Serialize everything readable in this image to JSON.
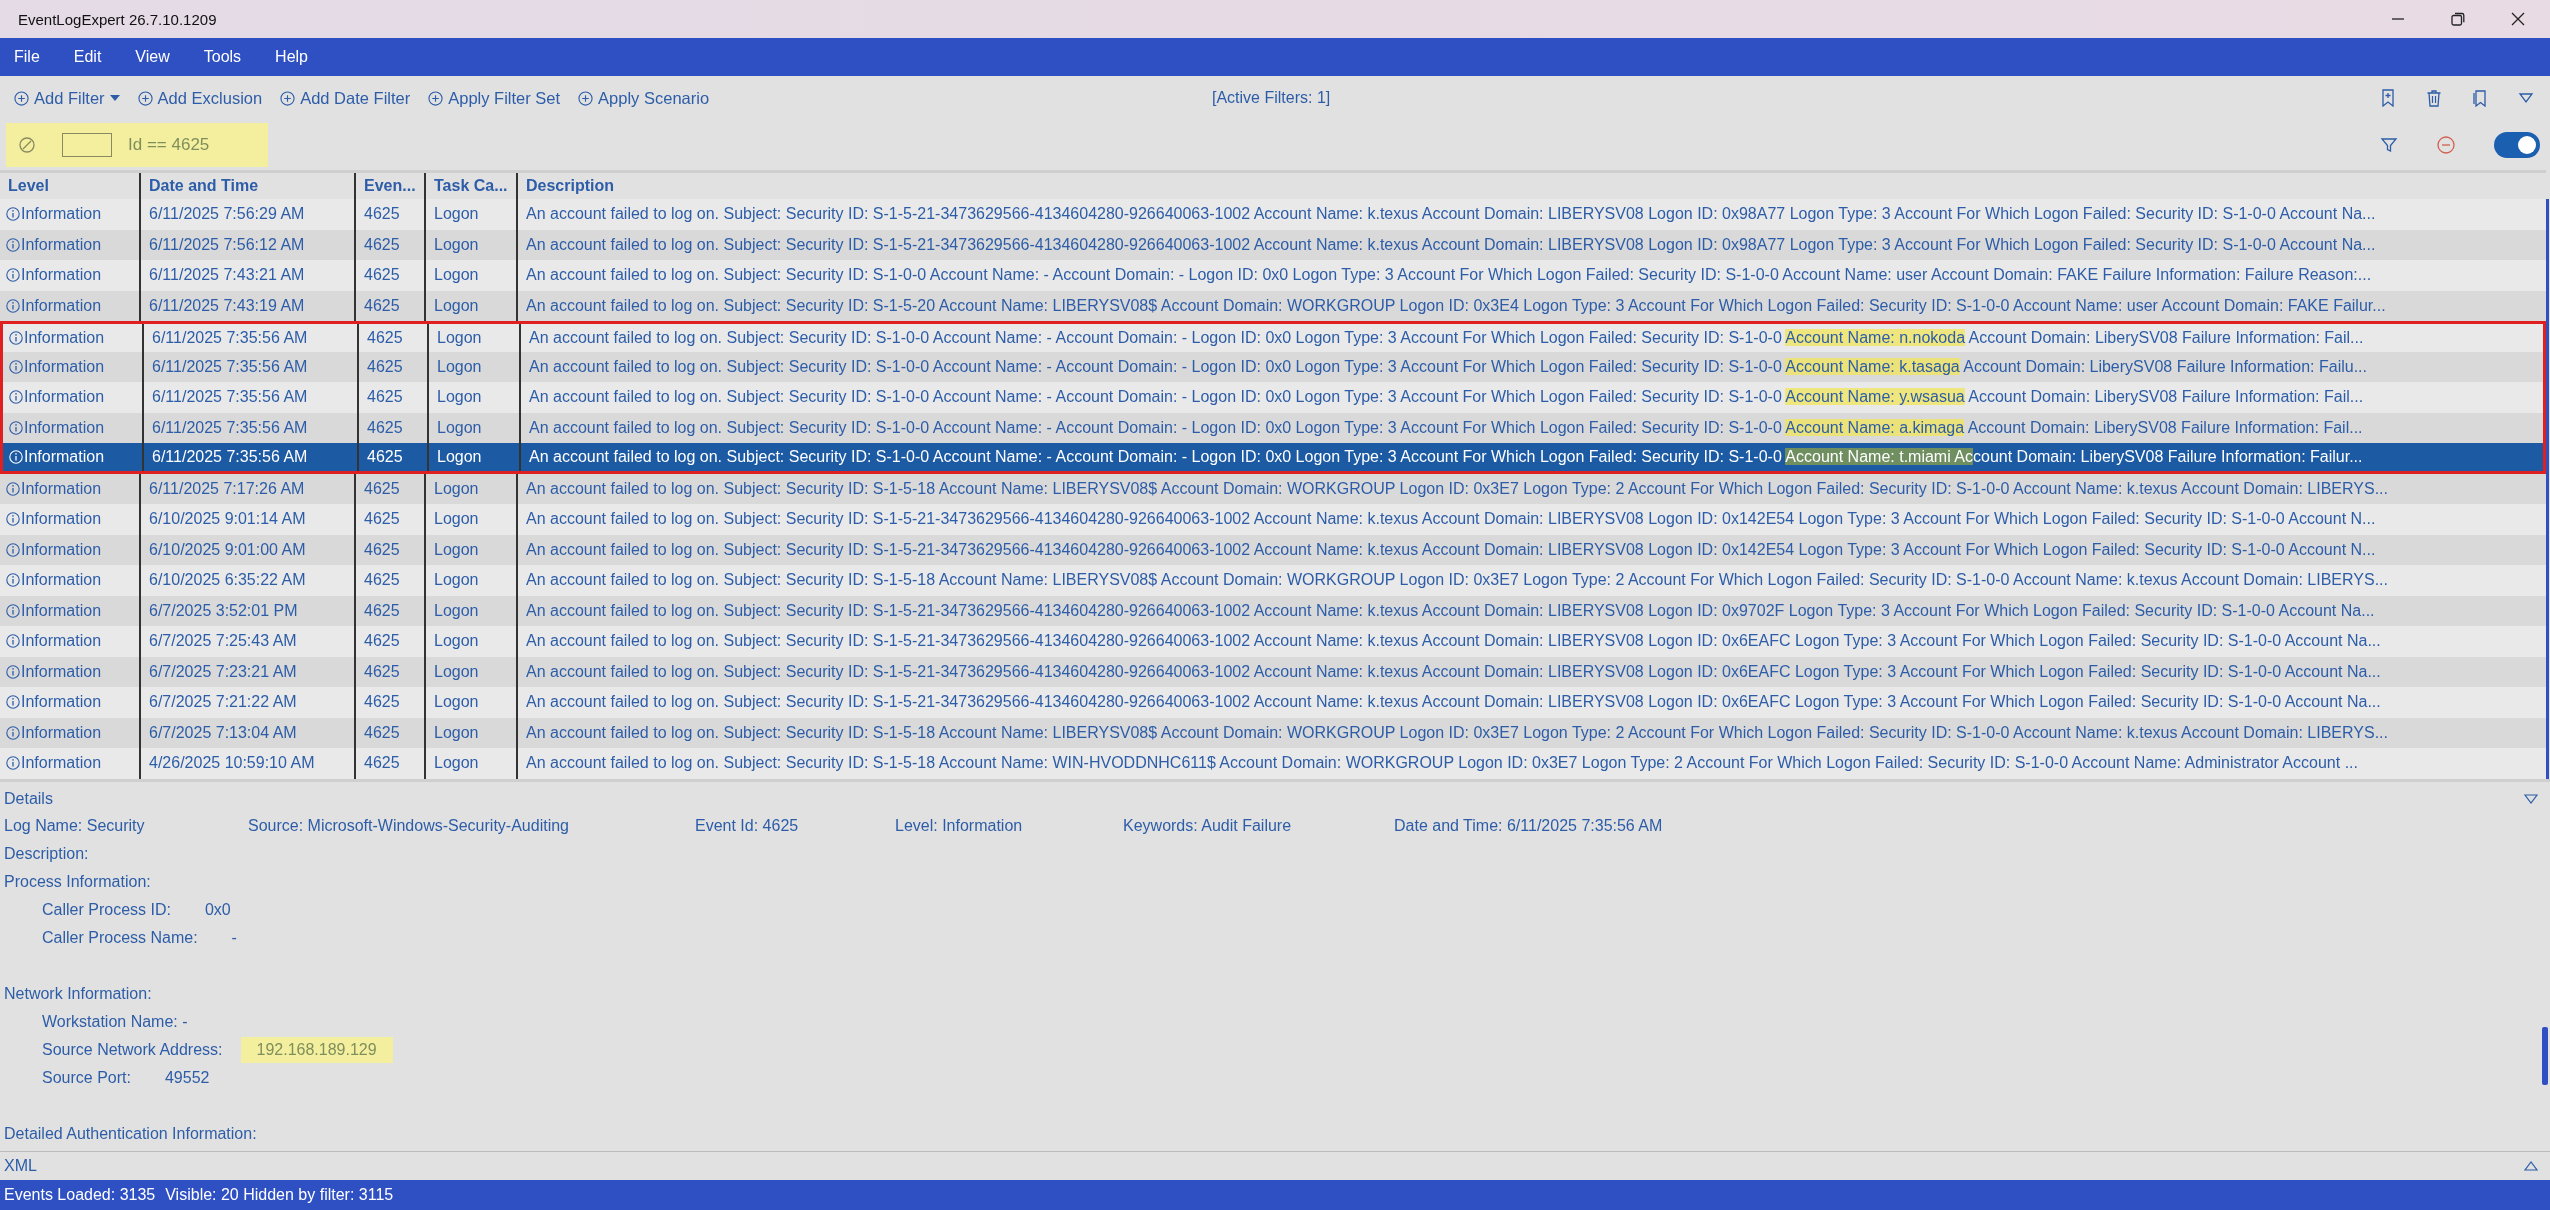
{
  "window": {
    "title": "EventLogExpert 26.7.10.1209"
  },
  "menu": [
    "File",
    "Edit",
    "View",
    "Tools",
    "Help"
  ],
  "toolbar": {
    "buttons": [
      {
        "label": "Add Filter",
        "dropdown": true
      },
      {
        "label": "Add Exclusion",
        "dropdown": false
      },
      {
        "label": "Add Date Filter",
        "dropdown": false
      },
      {
        "label": "Apply Filter Set",
        "dropdown": false
      },
      {
        "label": "Apply Scenario",
        "dropdown": false
      }
    ],
    "active_filters": "[Active Filters: 1]"
  },
  "filter": {
    "value": "Id == 4625",
    "highlighted": true,
    "enabled": true
  },
  "table": {
    "columns": [
      "Level",
      "Date and Time",
      "Even...",
      "Task Ca...",
      "Description"
    ],
    "rows": [
      {
        "level": "Information",
        "date": "6/11/2025 7:56:29 AM",
        "event_id": "4625",
        "task": "Logon",
        "selected": false,
        "outlined": false,
        "description": [
          {
            "text": "An account failed to log on. Subject: Security ID: S-1-5-21-3473629566-4134604280-926640063-1002 Account Name: k.texus Account Domain: LIBERYSV08 Logon ID: 0x98A77 Logon Type: 3 Account For Which Logon Failed: Security ID: S-1-0-0 Account Na...",
            "highlighted": false
          }
        ]
      },
      {
        "level": "Information",
        "date": "6/11/2025 7:56:12 AM",
        "event_id": "4625",
        "task": "Logon",
        "selected": false,
        "outlined": false,
        "description": [
          {
            "text": "An account failed to log on. Subject: Security ID: S-1-5-21-3473629566-4134604280-926640063-1002 Account Name: k.texus Account Domain: LIBERYSV08 Logon ID: 0x98A77 Logon Type: 3 Account For Which Logon Failed: Security ID: S-1-0-0 Account Na...",
            "highlighted": false
          }
        ]
      },
      {
        "level": "Information",
        "date": "6/11/2025 7:43:21 AM",
        "event_id": "4625",
        "task": "Logon",
        "selected": false,
        "outlined": false,
        "description": [
          {
            "text": "An account failed to log on. Subject: Security ID: S-1-0-0 Account Name: - Account Domain: - Logon ID: 0x0 Logon Type: 3 Account For Which Logon Failed: Security ID: S-1-0-0 Account Name: user Account Domain: FAKE Failure Information: Failure Reason:...",
            "highlighted": false
          }
        ]
      },
      {
        "level": "Information",
        "date": "6/11/2025 7:43:19 AM",
        "event_id": "4625",
        "task": "Logon",
        "selected": false,
        "outlined": false,
        "description": [
          {
            "text": "An account failed to log on. Subject: Security ID: S-1-5-20 Account Name: LIBERYSV08$ Account Domain: WORKGROUP Logon ID: 0x3E4 Logon Type: 3 Account For Which Logon Failed: Security ID: S-1-0-0 Account Name: user Account Domain: FAKE Failur...",
            "highlighted": false
          }
        ]
      },
      {
        "level": "Information",
        "date": "6/11/2025 7:35:56 AM",
        "event_id": "4625",
        "task": "Logon",
        "selected": false,
        "outlined": true,
        "description": [
          {
            "text": "An account failed to log on. Subject: Security ID: S-1-0-0 Account Name: - Account Domain: - Logon ID: 0x0 Logon Type: 3 Account For Which Logon Failed: Security ID: S-1-0-0 ",
            "highlighted": false
          },
          {
            "text": "Account Name: n.nokoda",
            "highlighted": true
          },
          {
            "text": " Account Domain: LiberySV08 Failure Information: Fail...",
            "highlighted": false
          }
        ]
      },
      {
        "level": "Information",
        "date": "6/11/2025 7:35:56 AM",
        "event_id": "4625",
        "task": "Logon",
        "selected": false,
        "outlined": true,
        "description": [
          {
            "text": "An account failed to log on. Subject: Security ID: S-1-0-0 Account Name: - Account Domain: - Logon ID: 0x0 Logon Type: 3 Account For Which Logon Failed: Security ID: S-1-0-0 ",
            "highlighted": false
          },
          {
            "text": "Account Name: k.tasaga",
            "highlighted": true
          },
          {
            "text": " Account Domain: LiberySV08 Failure Information: Failu...",
            "highlighted": false
          }
        ]
      },
      {
        "level": "Information",
        "date": "6/11/2025 7:35:56 AM",
        "event_id": "4625",
        "task": "Logon",
        "selected": false,
        "outlined": true,
        "description": [
          {
            "text": "An account failed to log on. Subject: Security ID: S-1-0-0 Account Name: - Account Domain: - Logon ID: 0x0 Logon Type: 3 Account For Which Logon Failed: Security ID: S-1-0-0 ",
            "highlighted": false
          },
          {
            "text": "Account Name: y.wsasua",
            "highlighted": true
          },
          {
            "text": " Account Domain: LiberySV08 Failure Information: Fail...",
            "highlighted": false
          }
        ]
      },
      {
        "level": "Information",
        "date": "6/11/2025 7:35:56 AM",
        "event_id": "4625",
        "task": "Logon",
        "selected": false,
        "outlined": true,
        "description": [
          {
            "text": "An account failed to log on. Subject: Security ID: S-1-0-0 Account Name: - Account Domain: - Logon ID: 0x0 Logon Type: 3 Account For Which Logon Failed: Security ID: S-1-0-0 ",
            "highlighted": false
          },
          {
            "text": "Account Name: a.kimaga",
            "highlighted": true
          },
          {
            "text": " Account Domain: LiberySV08 Failure Information: Fail...",
            "highlighted": false
          }
        ]
      },
      {
        "level": "Information",
        "date": "6/11/2025 7:35:56 AM",
        "event_id": "4625",
        "task": "Logon",
        "selected": true,
        "outlined": true,
        "description": [
          {
            "text": "An account failed to log on. Subject: Security ID: S-1-0-0 Account Name: - Account Domain: - Logon ID: 0x0 Logon Type: 3 Account For Which Logon Failed: Security ID: S-1-0-0 ",
            "highlighted": false
          },
          {
            "text": "Account Name: t.miami Ac",
            "highlighted": true
          },
          {
            "text": "count Domain: LiberySV08 Failure Information: Failur...",
            "highlighted": false
          }
        ]
      },
      {
        "level": "Information",
        "date": "6/11/2025 7:17:26 AM",
        "event_id": "4625",
        "task": "Logon",
        "selected": false,
        "outlined": false,
        "description": [
          {
            "text": "An account failed to log on. Subject: Security ID: S-1-5-18 Account Name: LIBERYSV08$ Account Domain: WORKGROUP Logon ID: 0x3E7 Logon Type: 2 Account For Which Logon Failed: Security ID: S-1-0-0 Account Name: k.texus Account Domain: LIBERYS...",
            "highlighted": false
          }
        ]
      },
      {
        "level": "Information",
        "date": "6/10/2025 9:01:14 AM",
        "event_id": "4625",
        "task": "Logon",
        "selected": false,
        "outlined": false,
        "description": [
          {
            "text": "An account failed to log on. Subject: Security ID: S-1-5-21-3473629566-4134604280-926640063-1002 Account Name: k.texus Account Domain: LIBERYSV08 Logon ID: 0x142E54 Logon Type: 3 Account For Which Logon Failed: Security ID: S-1-0-0 Account N...",
            "highlighted": false
          }
        ]
      },
      {
        "level": "Information",
        "date": "6/10/2025 9:01:00 AM",
        "event_id": "4625",
        "task": "Logon",
        "selected": false,
        "outlined": false,
        "description": [
          {
            "text": "An account failed to log on. Subject: Security ID: S-1-5-21-3473629566-4134604280-926640063-1002 Account Name: k.texus Account Domain: LIBERYSV08 Logon ID: 0x142E54 Logon Type: 3 Account For Which Logon Failed: Security ID: S-1-0-0 Account N...",
            "highlighted": false
          }
        ]
      },
      {
        "level": "Information",
        "date": "6/10/2025 6:35:22 AM",
        "event_id": "4625",
        "task": "Logon",
        "selected": false,
        "outlined": false,
        "description": [
          {
            "text": "An account failed to log on. Subject: Security ID: S-1-5-18 Account Name: LIBERYSV08$ Account Domain: WORKGROUP Logon ID: 0x3E7 Logon Type: 2 Account For Which Logon Failed: Security ID: S-1-0-0 Account Name: k.texus Account Domain: LIBERYS...",
            "highlighted": false
          }
        ]
      },
      {
        "level": "Information",
        "date": "6/7/2025 3:52:01 PM",
        "event_id": "4625",
        "task": "Logon",
        "selected": false,
        "outlined": false,
        "description": [
          {
            "text": "An account failed to log on. Subject: Security ID: S-1-5-21-3473629566-4134604280-926640063-1002 Account Name: k.texus Account Domain: LIBERYSV08 Logon ID: 0x9702F Logon Type: 3 Account For Which Logon Failed: Security ID: S-1-0-0 Account Na...",
            "highlighted": false
          }
        ]
      },
      {
        "level": "Information",
        "date": "6/7/2025 7:25:43 AM",
        "event_id": "4625",
        "task": "Logon",
        "selected": false,
        "outlined": false,
        "description": [
          {
            "text": "An account failed to log on. Subject: Security ID: S-1-5-21-3473629566-4134604280-926640063-1002 Account Name: k.texus Account Domain: LIBERYSV08 Logon ID: 0x6EAFC Logon Type: 3 Account For Which Logon Failed: Security ID: S-1-0-0 Account Na...",
            "highlighted": false
          }
        ]
      },
      {
        "level": "Information",
        "date": "6/7/2025 7:23:21 AM",
        "event_id": "4625",
        "task": "Logon",
        "selected": false,
        "outlined": false,
        "description": [
          {
            "text": "An account failed to log on. Subject: Security ID: S-1-5-21-3473629566-4134604280-926640063-1002 Account Name: k.texus Account Domain: LIBERYSV08 Logon ID: 0x6EAFC Logon Type: 3 Account For Which Logon Failed: Security ID: S-1-0-0 Account Na...",
            "highlighted": false
          }
        ]
      },
      {
        "level": "Information",
        "date": "6/7/2025 7:21:22 AM",
        "event_id": "4625",
        "task": "Logon",
        "selected": false,
        "outlined": false,
        "description": [
          {
            "text": "An account failed to log on. Subject: Security ID: S-1-5-21-3473629566-4134604280-926640063-1002 Account Name: k.texus Account Domain: LIBERYSV08 Logon ID: 0x6EAFC Logon Type: 3 Account For Which Logon Failed: Security ID: S-1-0-0 Account Na...",
            "highlighted": false
          }
        ]
      },
      {
        "level": "Information",
        "date": "6/7/2025 7:13:04 AM",
        "event_id": "4625",
        "task": "Logon",
        "selected": false,
        "outlined": false,
        "description": [
          {
            "text": "An account failed to log on. Subject: Security ID: S-1-5-18 Account Name: LIBERYSV08$ Account Domain: WORKGROUP Logon ID: 0x3E7 Logon Type: 2 Account For Which Logon Failed: Security ID: S-1-0-0 Account Name: k.texus Account Domain: LIBERYS...",
            "highlighted": false
          }
        ]
      },
      {
        "level": "Information",
        "date": "4/26/2025 10:59:10 AM",
        "event_id": "4625",
        "task": "Logon",
        "selected": false,
        "outlined": false,
        "description": [
          {
            "text": "An account failed to log on. Subject: Security ID: S-1-5-18 Account Name: WIN-HVODDNHC611$ Account Domain: WORKGROUP Logon ID: 0x3E7 Logon Type: 2 Account For Which Logon Failed: Security ID: S-1-0-0 Account Name: Administrator Account ...",
            "highlighted": false
          }
        ]
      }
    ]
  },
  "details": {
    "title": "Details",
    "summary": [
      "Log Name: Security",
      "Source: Microsoft-Windows-Security-Auditing",
      "Event Id: 4625",
      "Level: Information",
      "Keywords: Audit Failure",
      "Date and Time: 6/11/2025 7:35:56 AM"
    ],
    "lines": [
      {
        "kind": "heading",
        "label": "Description:"
      },
      {
        "kind": "heading",
        "label": "Process Information:"
      },
      {
        "kind": "field",
        "label": "Caller Process ID:",
        "value": "0x0",
        "highlighted": false
      },
      {
        "kind": "field",
        "label": "Caller Process Name:",
        "value": "-",
        "highlighted": false
      },
      {
        "kind": "gap"
      },
      {
        "kind": "heading",
        "label": "Network Information:"
      },
      {
        "kind": "field",
        "label": "Workstation Name: -"
      },
      {
        "kind": "field",
        "label": "Source Network Address:",
        "value": "192.168.189.129",
        "highlighted": true
      },
      {
        "kind": "field",
        "label": "Source Port:",
        "value": "49552",
        "highlighted": false
      },
      {
        "kind": "gap"
      },
      {
        "kind": "heading",
        "label": "Detailed Authentication Information:"
      }
    ]
  },
  "xml_section": {
    "title": "XML"
  },
  "status_bar": [
    "Events Loaded: 3135",
    "Visible: 20 Hidden by filter: 3115"
  ]
}
